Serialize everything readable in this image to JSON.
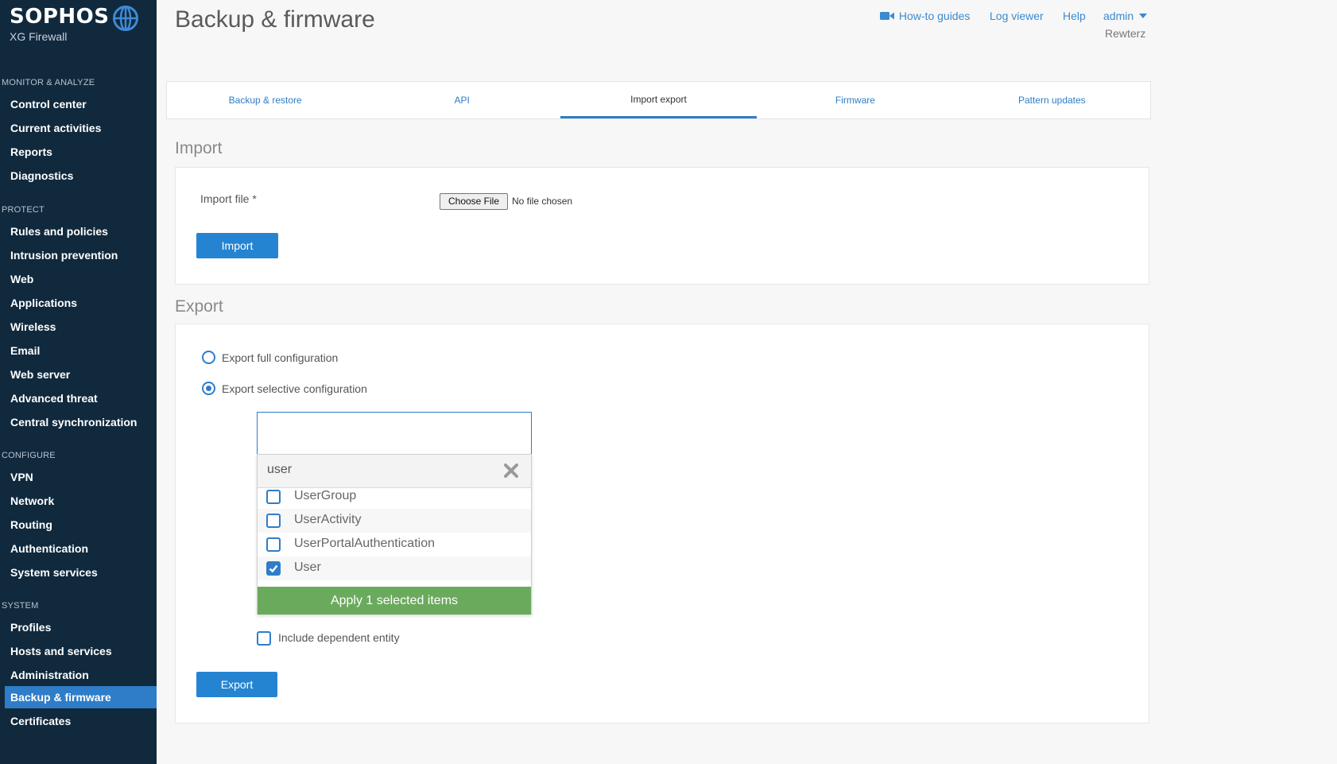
{
  "sidebar": {
    "brand": "SOPHOS",
    "product": "XG Firewall",
    "sections": [
      {
        "label": "MONITOR & ANALYZE",
        "items": [
          "Control center",
          "Current activities",
          "Reports",
          "Diagnostics"
        ]
      },
      {
        "label": "PROTECT",
        "items": [
          "Rules and policies",
          "Intrusion prevention",
          "Web",
          "Applications",
          "Wireless",
          "Email",
          "Web server",
          "Advanced threat",
          "Central synchronization"
        ]
      },
      {
        "label": "CONFIGURE",
        "items": [
          "VPN",
          "Network",
          "Routing",
          "Authentication",
          "System services"
        ]
      },
      {
        "label": "SYSTEM",
        "items": [
          "Profiles",
          "Hosts and services",
          "Administration",
          "Backup & firmware",
          "Certificates"
        ]
      }
    ],
    "active_item": "Backup & firmware",
    "colors": {
      "background": "#10293d",
      "active": "#2f7dc8"
    }
  },
  "header": {
    "title": "Backup & firmware",
    "links": {
      "howto": "How-to guides",
      "log_viewer": "Log viewer",
      "help": "Help",
      "admin": "admin"
    },
    "user": "Rewterz",
    "icons": {
      "howto": "video-camera-icon",
      "admin": "caret-down-icon"
    }
  },
  "tabs": [
    "Backup & restore",
    "API",
    "Import export",
    "Firmware",
    "Pattern updates"
  ],
  "active_tab": "Import export",
  "import": {
    "section_title": "Import",
    "file_label": "Import file *",
    "choose_file": "Choose File",
    "no_file": "No file chosen",
    "button": "Import"
  },
  "export": {
    "section_title": "Export",
    "option_full": "Export full configuration",
    "option_selective": "Export selective configuration",
    "selected_option": "selective",
    "dropdown": {
      "search_value": "user",
      "items": [
        {
          "label": "UserGroup",
          "checked": false
        },
        {
          "label": "UserActivity",
          "checked": false
        },
        {
          "label": "UserPortalAuthentication",
          "checked": false
        },
        {
          "label": "User",
          "checked": true
        }
      ],
      "apply_label": "Apply 1 selected items",
      "apply_color": "#6aaa5c"
    },
    "include_dependent": "Include dependent entity",
    "button": "Export"
  },
  "colors": {
    "accent": "#2584d1",
    "link": "#3a8ad0"
  }
}
